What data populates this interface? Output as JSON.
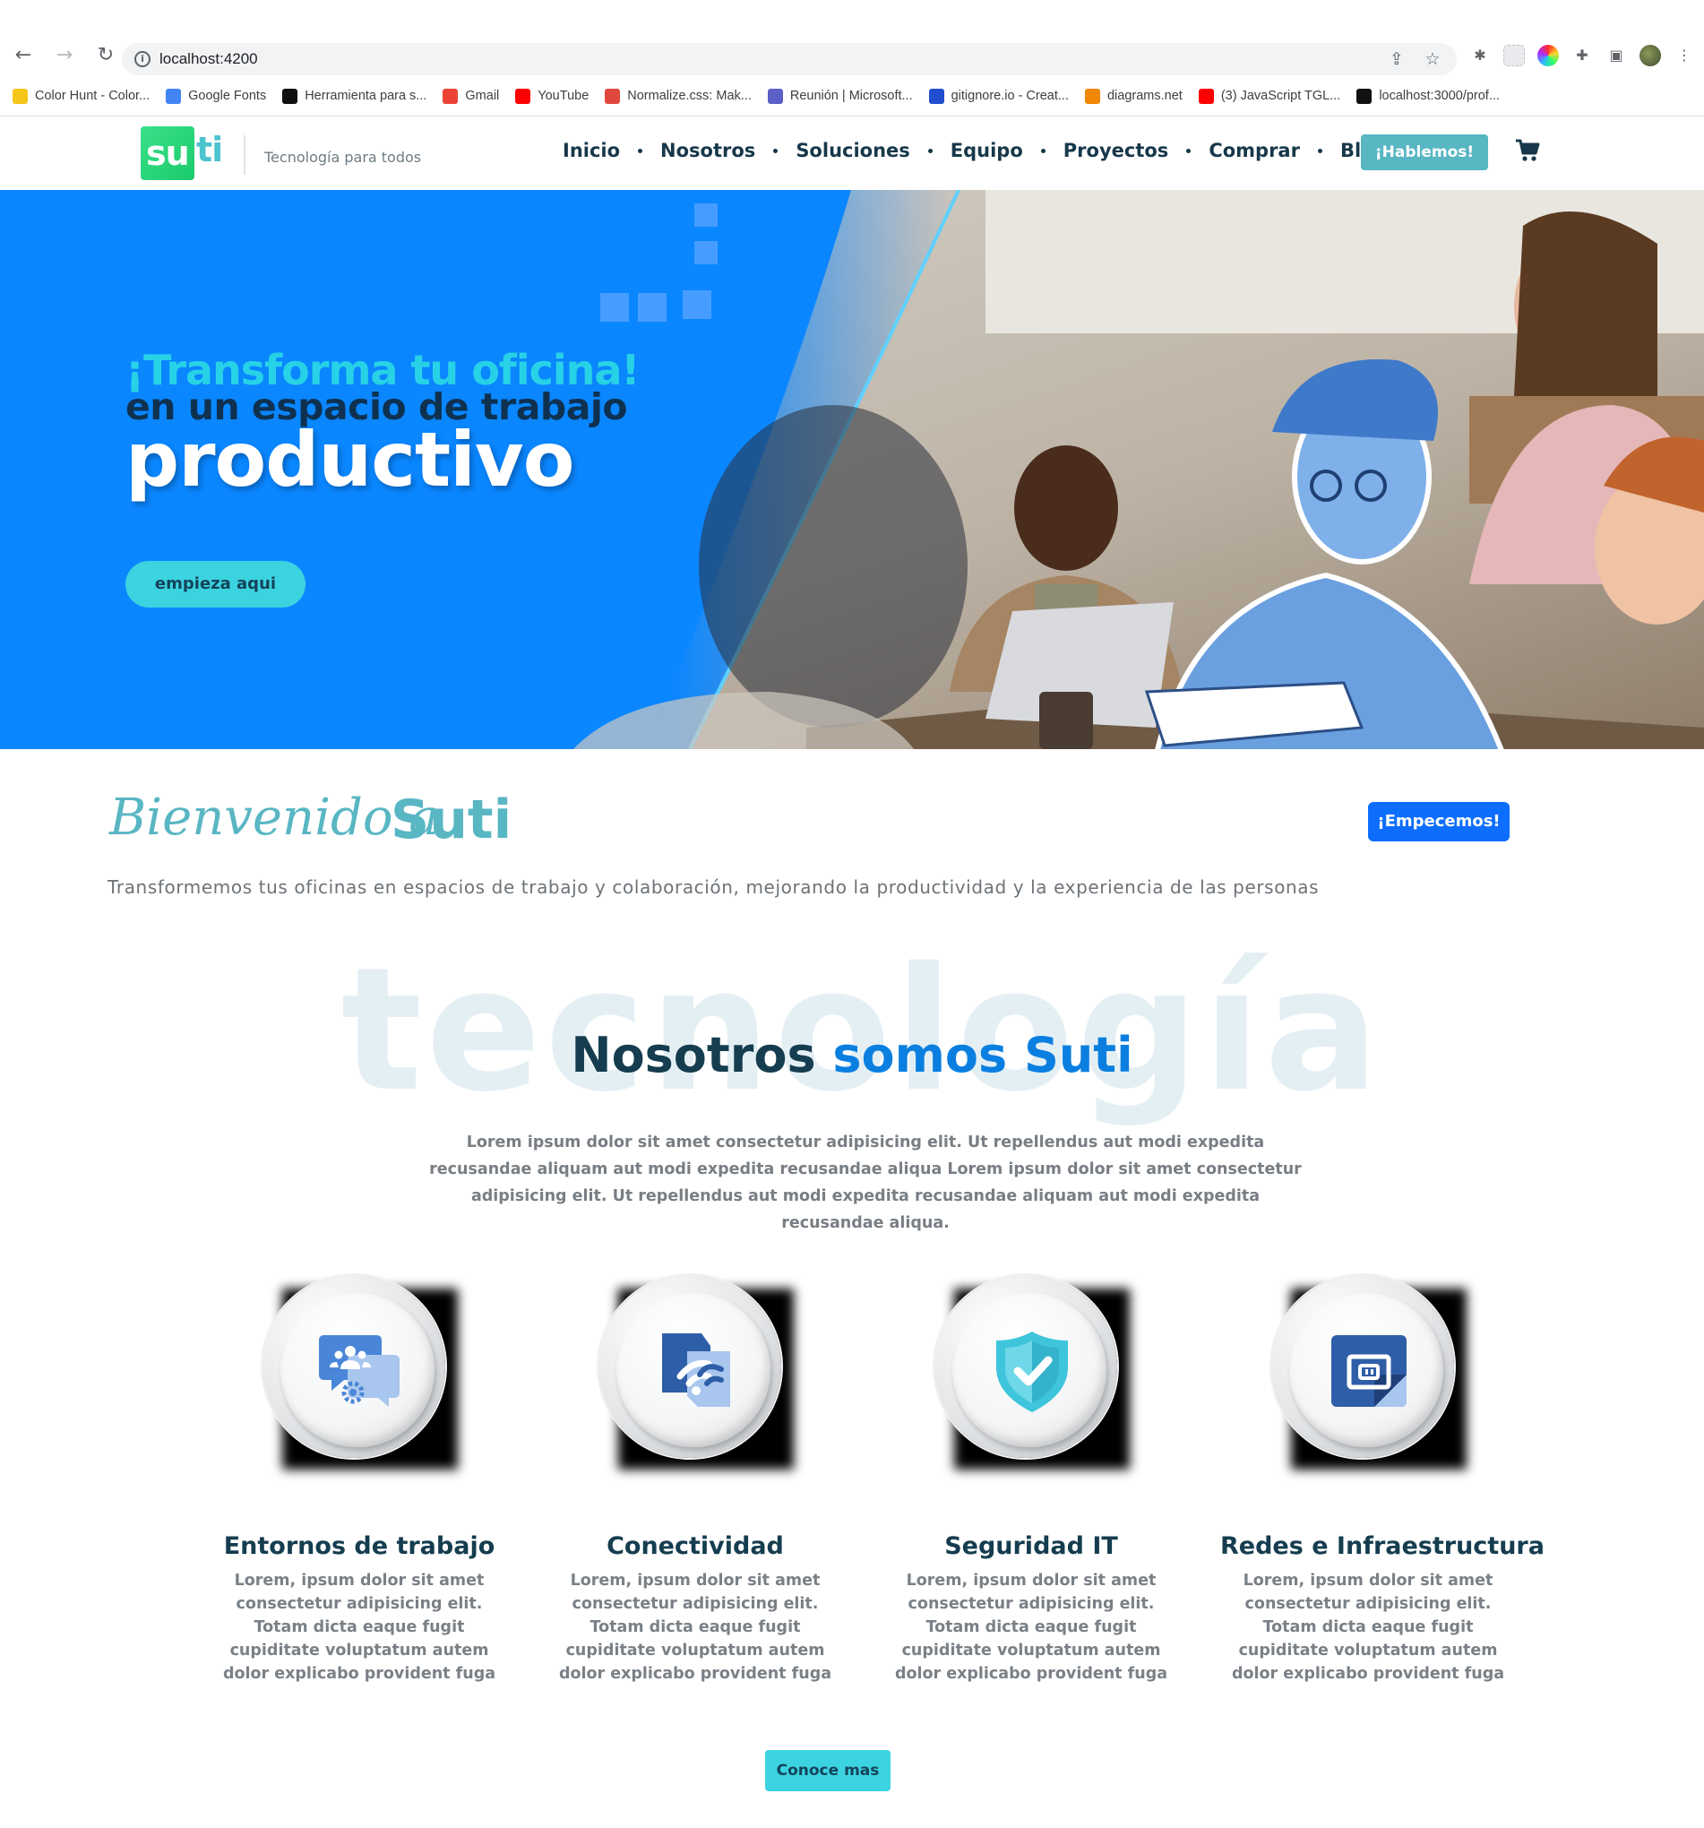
{
  "browser": {
    "url": "localhost:4200",
    "bookmarks": [
      {
        "label": "Color Hunt - Color...",
        "icon": "color-hunt-icon",
        "color": "#f5c518"
      },
      {
        "label": "Google Fonts",
        "icon": "google-fonts-icon",
        "color": "#4285f4"
      },
      {
        "label": "Herramienta para s...",
        "icon": "m-logo-icon",
        "color": "#111111"
      },
      {
        "label": "Gmail",
        "icon": "gmail-icon",
        "color": "#ea4335"
      },
      {
        "label": "YouTube",
        "icon": "youtube-icon",
        "color": "#ff0000"
      },
      {
        "label": "Normalize.css: Mak...",
        "icon": "normalize-icon",
        "color": "#e0483e"
      },
      {
        "label": "Reunión | Microsoft...",
        "icon": "teams-icon",
        "color": "#5b5fc7"
      },
      {
        "label": "gitignore.io - Creat...",
        "icon": "gitignore-icon",
        "color": "#204ecf"
      },
      {
        "label": "diagrams.net",
        "icon": "diagrams-icon",
        "color": "#f08705"
      },
      {
        "label": "(3) JavaScript TGL...",
        "icon": "youtube-icon",
        "color": "#ff0000"
      },
      {
        "label": "localhost:3000/prof...",
        "icon": "triangle-icon",
        "color": "#111111"
      }
    ]
  },
  "header": {
    "logo_su": "su",
    "logo_ti": "ti",
    "tagline": "Tecnología para todos",
    "nav": [
      "Inicio",
      "Nosotros",
      "Soluciones",
      "Equipo",
      "Proyectos",
      "Comprar",
      "Blog"
    ],
    "cta": "¡Hablemos!"
  },
  "hero": {
    "line1": "¡Transforma tu oficina!",
    "line2": "en un espacio de trabajo",
    "line3": "productivo",
    "button": "empieza aqui"
  },
  "welcome": {
    "script": "Bienvenido a",
    "brand": "Suti",
    "button": "¡Empecemos!",
    "subtitle": "Transformemos tus oficinas en espacios de trabajo y colaboración, mejorando la productividad y la experiencia de las personas"
  },
  "about": {
    "watermark": "tecnología",
    "title_dark": "Nosotros",
    "title_blue": "somos Suti",
    "text": "Lorem ipsum dolor sit amet consectetur adipisicing elit. Ut repellendus aut modi expedita recusandae aliquam aut modi expedita recusandae aliqua Lorem ipsum dolor sit amet consectetur adipisicing elit. Ut repellendus aut modi expedita recusandae aliquam aut modi expedita recusandae aliqua."
  },
  "features": [
    {
      "title": "Entornos de trabajo",
      "text": "Lorem, ipsum dolor sit amet consectetur adipisicing elit. Totam dicta eaque fugit cupiditate voluptatum autem dolor explicabo provident fuga",
      "icon": "workspace-chat-icon"
    },
    {
      "title": "Conectividad",
      "text": "Lorem, ipsum dolor sit amet consectetur adipisicing elit. Totam dicta eaque fugit cupiditate voluptatum autem dolor explicabo provident fuga",
      "icon": "wifi-document-icon"
    },
    {
      "title": "Seguridad IT",
      "text": "Lorem, ipsum dolor sit amet consectetur adipisicing elit. Totam dicta eaque fugit cupiditate voluptatum autem dolor explicabo provident fuga",
      "icon": "shield-check-icon"
    },
    {
      "title": "Redes e Infraestructura",
      "text": "Lorem, ipsum dolor sit amet consectetur adipisicing elit. Totam dicta eaque fugit cupiditate voluptatum autem dolor explicabo provident fuga",
      "icon": "network-port-icon"
    }
  ],
  "more_button": "Conoce mas",
  "colors": {
    "brand_teal": "#59b6c3",
    "hero_blue": "#0a86ff",
    "accent_cyan": "#3cd3e0",
    "primary_blue": "#0d6efd",
    "dark_navy": "#153d4f"
  }
}
